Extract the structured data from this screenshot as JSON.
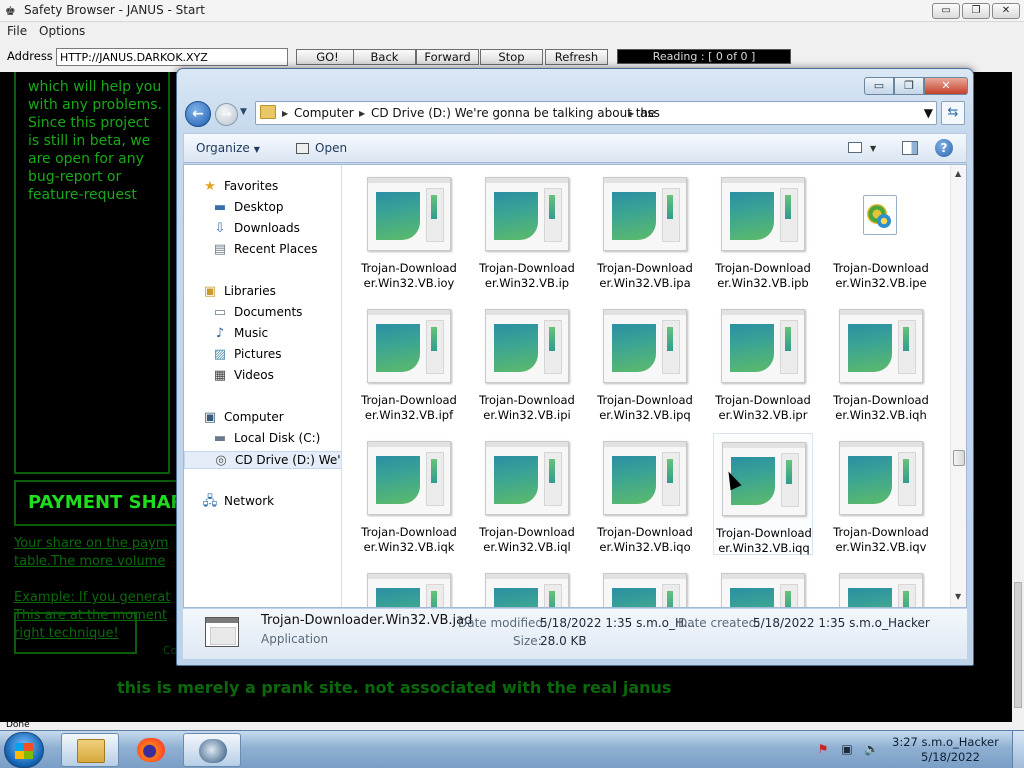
{
  "browser": {
    "title": "Safety Browser - JANUS - Start",
    "menu": [
      "File",
      "Options"
    ],
    "address_label": "Address :",
    "address_value": "HTTP://JANUS.DARKOK.XYZ",
    "buttons": {
      "go": "GO!",
      "back": "Back",
      "forward": "Forward",
      "stop": "Stop",
      "refresh": "Refresh"
    },
    "reading": "Reading : [ 0  of  0 ]",
    "status": "Done",
    "window_buttons": {
      "minimize": "▭",
      "maximize": "❐",
      "close": "✕"
    }
  },
  "page": {
    "intro_text": "which will help you with any problems. Since this project is still in beta, we are open for any bug-report or feature-request",
    "payment_title": "PAYMENT SHAR",
    "dim_lines": [
      "Your share on the paym",
      "table.The more volume",
      "Example: If you generat",
      "This are at the moment",
      "right technique!"
    ],
    "dim_co": "Co",
    "prank_note": "this is merely a prank site. not associated with the real janus"
  },
  "explorer": {
    "breadcrumb": [
      "Computer",
      "CD Drive (D:) We're gonna be talking about the",
      "ass"
    ],
    "toolbar": {
      "organize": "Organize",
      "open": "Open"
    },
    "nav": {
      "favorites": "Favorites",
      "desktop": "Desktop",
      "downloads": "Downloads",
      "recent": "Recent Places",
      "libraries": "Libraries",
      "documents": "Documents",
      "music": "Music",
      "pictures": "Pictures",
      "videos": "Videos",
      "computer": "Computer",
      "local_disk": "Local Disk (C:)",
      "cd_drive": "CD Drive (D:) We're g",
      "network": "Network"
    },
    "files": [
      {
        "line1": "Trojan-Download",
        "line2": "er.Win32.VB.ioy",
        "icon": "thumbnail"
      },
      {
        "line1": "Trojan-Download",
        "line2": "er.Win32.VB.ip",
        "icon": "thumbnail"
      },
      {
        "line1": "Trojan-Download",
        "line2": "er.Win32.VB.ipa",
        "icon": "thumbnail"
      },
      {
        "line1": "Trojan-Download",
        "line2": "er.Win32.VB.ipb",
        "icon": "thumbnail"
      },
      {
        "line1": "Trojan-Download",
        "line2": "er.Win32.VB.ipe",
        "icon": "config-gear"
      },
      {
        "line1": "Trojan-Download",
        "line2": "er.Win32.VB.ipf",
        "icon": "thumbnail"
      },
      {
        "line1": "Trojan-Download",
        "line2": "er.Win32.VB.ipi",
        "icon": "thumbnail"
      },
      {
        "line1": "Trojan-Download",
        "line2": "er.Win32.VB.ipq",
        "icon": "thumbnail"
      },
      {
        "line1": "Trojan-Download",
        "line2": "er.Win32.VB.ipr",
        "icon": "thumbnail"
      },
      {
        "line1": "Trojan-Download",
        "line2": "er.Win32.VB.iqh",
        "icon": "thumbnail"
      },
      {
        "line1": "Trojan-Download",
        "line2": "er.Win32.VB.iqk",
        "icon": "thumbnail"
      },
      {
        "line1": "Trojan-Download",
        "line2": "er.Win32.VB.iql",
        "icon": "thumbnail"
      },
      {
        "line1": "Trojan-Download",
        "line2": "er.Win32.VB.iqo",
        "icon": "thumbnail"
      },
      {
        "line1": "Trojan-Download",
        "line2": "er.Win32.VB.iqq",
        "icon": "thumbnail"
      },
      {
        "line1": "Trojan-Download",
        "line2": "er.Win32.VB.iqv",
        "icon": "thumbnail"
      },
      {
        "line1": "",
        "line2": "",
        "icon": "thumbnail"
      },
      {
        "line1": "",
        "line2": "",
        "icon": "thumbnail"
      },
      {
        "line1": "",
        "line2": "",
        "icon": "thumbnail"
      },
      {
        "line1": "",
        "line2": "",
        "icon": "thumbnail"
      },
      {
        "line1": "",
        "line2": "",
        "icon": "thumbnail"
      }
    ],
    "hovered_file_index": 13,
    "details": {
      "name": "Trojan-Downloader.Win32.VB.jad",
      "type": "Application",
      "modified_label": "Date modified:",
      "modified_value": "5/18/2022 1:35 s.m.o_H...",
      "created_label": "Date created:",
      "created_value": "5/18/2022 1:35 s.m.o_Hacker",
      "size_label": "Size:",
      "size_value": "28.0 KB"
    }
  },
  "taskbar": {
    "clock_time": "3:27 s.m.o_Hacker",
    "clock_date": "5/18/2022",
    "apps": [
      "folder-icon",
      "firefox-icon",
      "globe-icon"
    ]
  },
  "colors": {
    "page_green": "#19a819",
    "page_dim_green": "#0b6a0b",
    "explorer_frame": "#c6d9ee",
    "taskbar": "#8fb0d2"
  }
}
